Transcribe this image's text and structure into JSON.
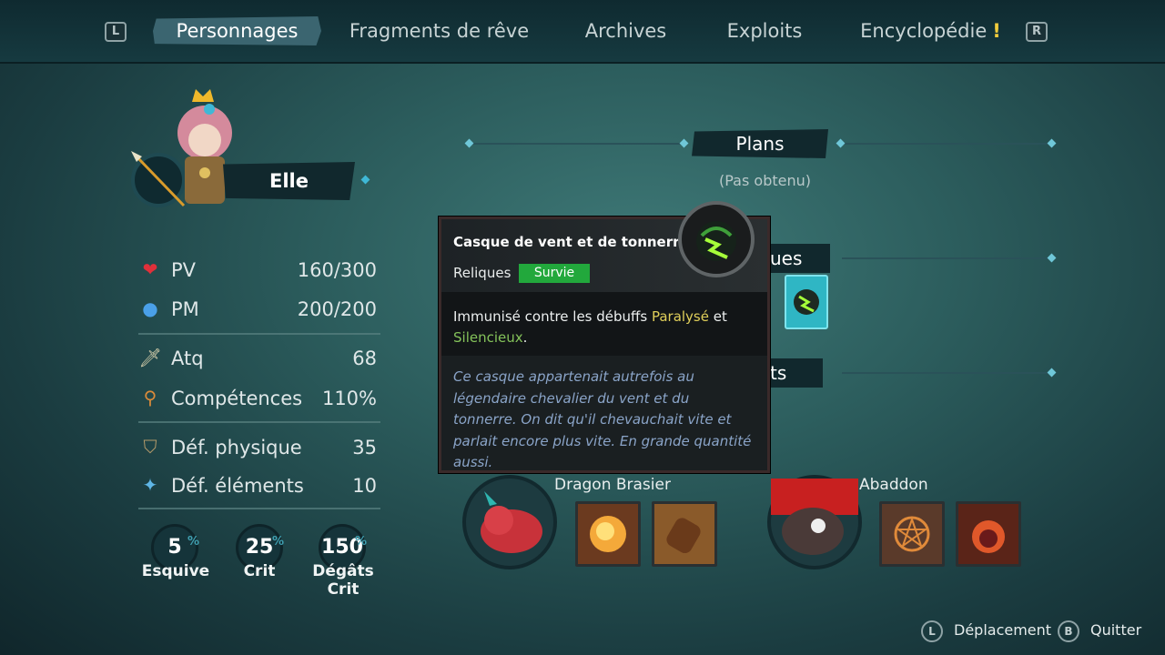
{
  "nav": {
    "left_key": "L",
    "right_key": "R",
    "tabs": [
      {
        "label": "Personnages"
      },
      {
        "label": "Fragments de rêve"
      },
      {
        "label": "Archives"
      },
      {
        "label": "Exploits"
      },
      {
        "label": "Encyclopédie",
        "badge": "!"
      }
    ],
    "active_tab": "Personnages"
  },
  "character": {
    "name": "Elle",
    "stats": [
      {
        "icon": "heart-icon",
        "label": "PV",
        "value": "160/300"
      },
      {
        "icon": "mana-potion-icon",
        "label": "PM",
        "value": "200/200"
      },
      {
        "icon": "sword-icon",
        "label": "Atq",
        "value": "68"
      },
      {
        "icon": "magnifier-icon",
        "label": "Compétences",
        "value": "110%"
      },
      {
        "icon": "shield-icon",
        "label": "Déf. physique",
        "value": "35"
      },
      {
        "icon": "elemental-shield-icon",
        "label": "Déf. éléments",
        "value": "10"
      }
    ],
    "bubbles": [
      {
        "value": "5",
        "label": "Esquive"
      },
      {
        "value": "25",
        "label": "Crit"
      },
      {
        "value": "150",
        "label": "Dégâts Crit"
      }
    ]
  },
  "sections": {
    "plans_title": "Plans",
    "plans_status": "(Pas obtenu)",
    "relics_title_partial": "ues",
    "third_title_partial": "ts"
  },
  "tooltip": {
    "title": "Casque de vent et de tonnerre",
    "type": "Reliques",
    "badge": "Survie",
    "badge_color": "#22a83c",
    "desc_prefix": "Immunisé contre les débuffs ",
    "desc_kw1": "Paralysé",
    "desc_mid": " et",
    "desc_kw2": "Silencieux",
    "desc_end": ".",
    "lore": "Ce casque appartenait autrefois au légendaire chevalier du vent et du tonnerre. On dit qu'il chevauchait vite et parlait encore plus vite. En grande quantité aussi."
  },
  "pets": [
    {
      "name": "Dragon Brasier",
      "skills": [
        "explosion-skill-icon",
        "barrel-skill-icon"
      ]
    },
    {
      "name": "Abaddon",
      "skills": [
        "pentagram-skill-icon",
        "fire-orb-skill-icon"
      ]
    }
  ],
  "footer": {
    "move_key": "L",
    "move_label": "Déplacement",
    "quit_key": "B",
    "quit_label": "Quitter"
  }
}
